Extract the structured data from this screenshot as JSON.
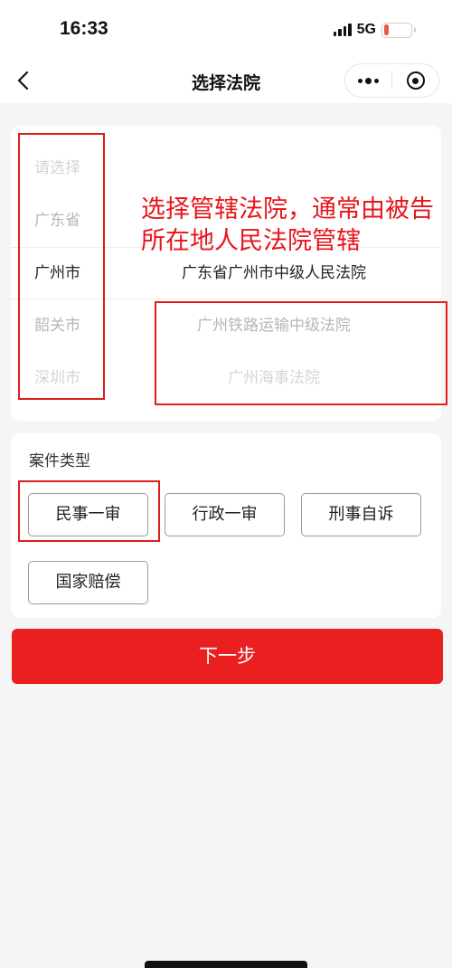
{
  "status_bar": {
    "time": "16:33",
    "network": "5G",
    "battery": "17",
    "battery_level": 0.17,
    "battery_color": "#e8584f"
  },
  "nav": {
    "title": "选择法院",
    "back_icon": "chevron-left-icon",
    "more_icon": "more-dots-icon",
    "close_icon": "miniprogram-close-icon"
  },
  "picker": {
    "provinces": [
      "请选择",
      "广东省",
      "广州市",
      "韶关市",
      "深圳市"
    ],
    "courts": [
      "广东省广州市中级人民法院",
      "广州铁路运输中级法院",
      "广州海事法院"
    ]
  },
  "case_type": {
    "title": "案件类型",
    "options": [
      "民事一审",
      "行政一审",
      "刑事自诉",
      "国家赔偿"
    ]
  },
  "next_button": "下一步",
  "annotation": "选择管辖法院，通常由被告\n所在地人民法院管辖",
  "colors": {
    "accent": "#ea1f1f",
    "annotation": "#e01c1c"
  }
}
